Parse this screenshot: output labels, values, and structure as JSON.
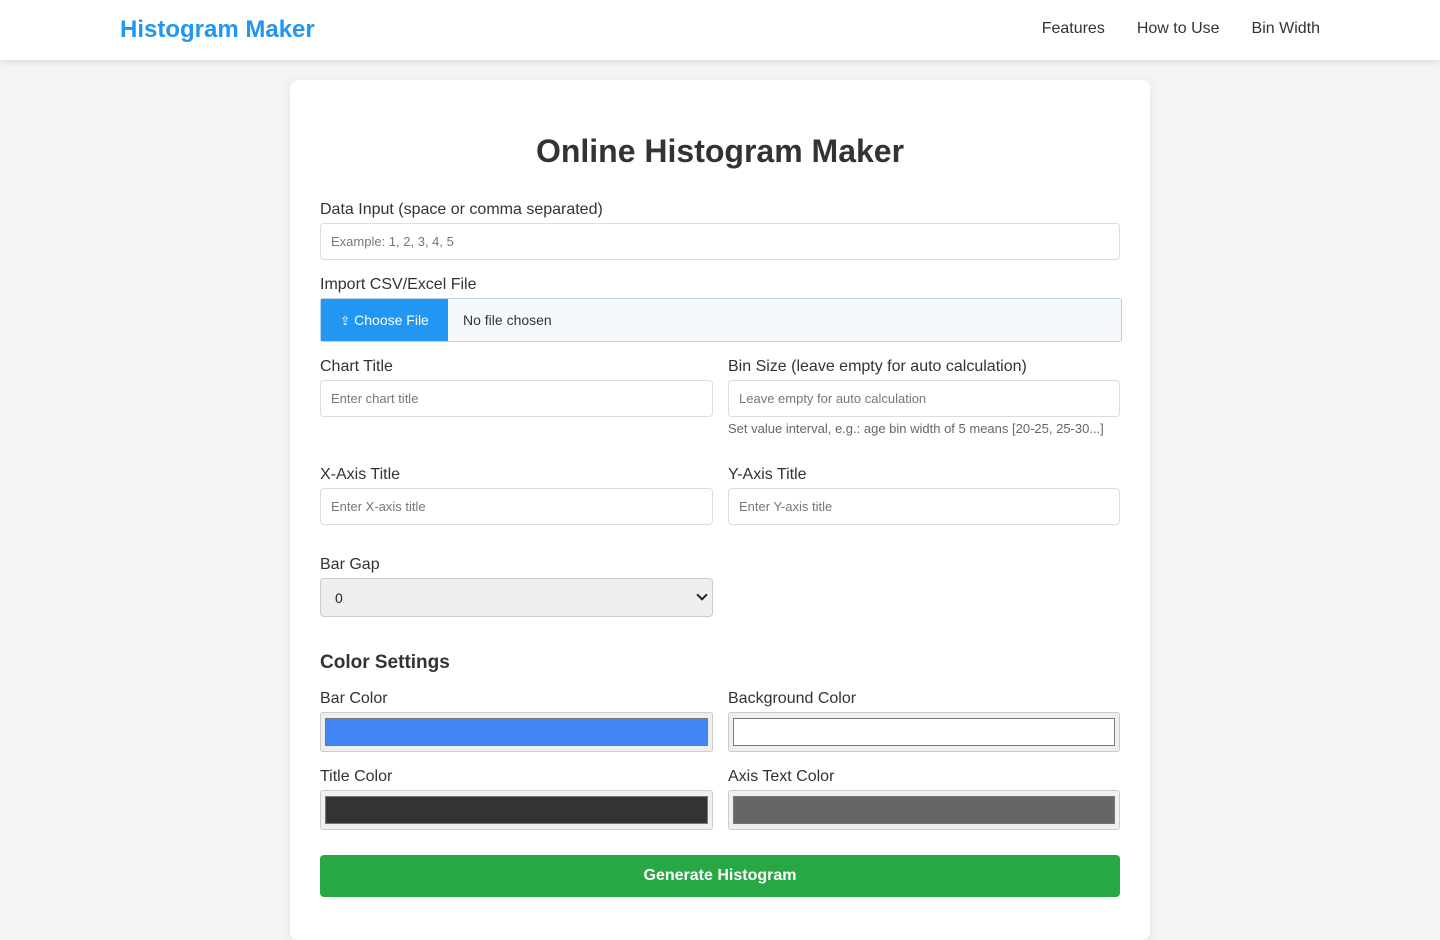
{
  "nav": {
    "brand": "Histogram Maker",
    "links": [
      "Features",
      "How to Use",
      "Bin Width"
    ]
  },
  "main": {
    "title": "Online Histogram Maker",
    "data_input": {
      "label": "Data Input (space or comma separated)",
      "placeholder": "Example: 1, 2, 3, 4, 5"
    },
    "file_import": {
      "label": "Import CSV/Excel File",
      "button_label": "Choose File",
      "button_icon": "upload-icon",
      "status": "No file chosen"
    },
    "chart_title": {
      "label": "Chart Title",
      "placeholder": "Enter chart title"
    },
    "bin_size": {
      "label": "Bin Size (leave empty for auto calculation)",
      "placeholder": "Leave empty for auto calculation",
      "hint": "Set value interval, e.g.: age bin width of 5 means [20-25, 25-30...]"
    },
    "x_axis": {
      "label": "X-Axis Title",
      "placeholder": "Enter X-axis title"
    },
    "y_axis": {
      "label": "Y-Axis Title",
      "placeholder": "Enter Y-axis title"
    },
    "bar_gap": {
      "label": "Bar Gap",
      "value": "0"
    },
    "colors": {
      "section_title": "Color Settings",
      "bar": {
        "label": "Bar Color",
        "value": "#4285f4"
      },
      "background": {
        "label": "Background Color",
        "value": "#ffffff"
      },
      "title": {
        "label": "Title Color",
        "value": "#333333"
      },
      "axis_text": {
        "label": "Axis Text Color",
        "value": "#666666"
      }
    },
    "generate_label": "Generate Histogram"
  },
  "theme": {
    "brand_blue": "#2196f3",
    "generate_green": "#28a745"
  }
}
